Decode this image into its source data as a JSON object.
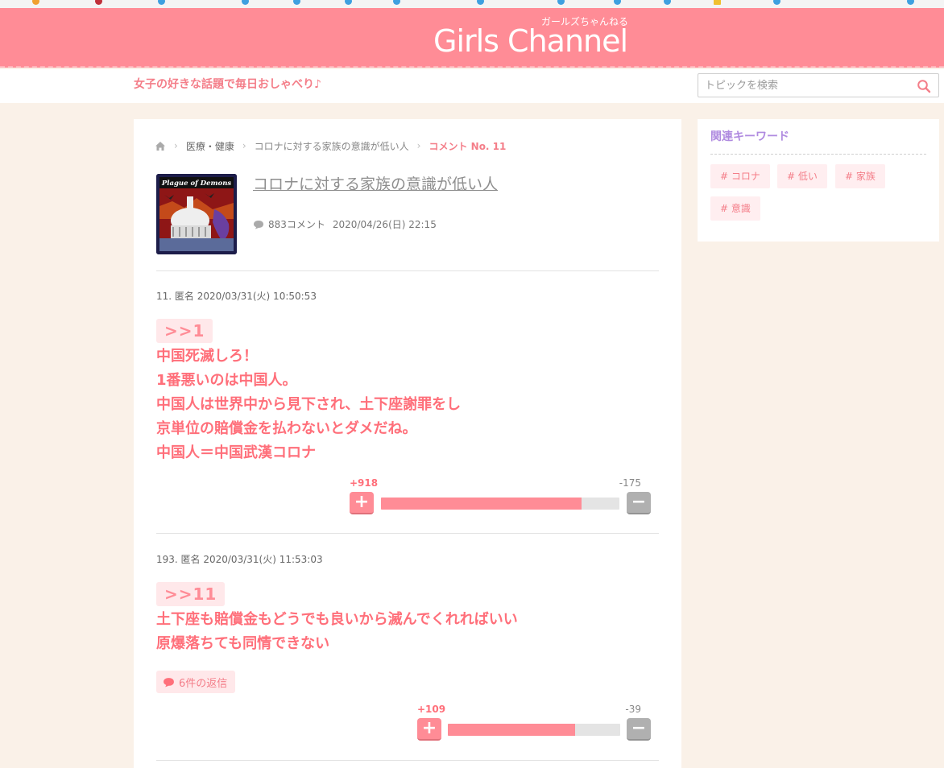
{
  "header": {
    "logo": "Girls Channel",
    "logo_sub": "ガールズちゃんねる",
    "tagline": "女子の好きな話題で毎日おしゃべり♪",
    "search_placeholder": "トピックを検索"
  },
  "breadcrumb": {
    "items": [
      "医療・健康",
      "コロナに対する家族の意識が低い人",
      "コメント No. 11"
    ]
  },
  "topic": {
    "title": "コロナに対する家族の意識が低い人",
    "comment_count": "883コメント",
    "date": "2020/04/26(日) 22:15",
    "thumbnail_caption": "Plague of Demons"
  },
  "comments": [
    {
      "header": "11. 匿名 2020/03/31(火) 10:50:53",
      "anchor": ">>1",
      "lines": [
        "中国死滅しろ！",
        "1番悪いのは中国人。",
        "中国人は世界中から見下され、土下座謝罪をし",
        "京単位の賠償金を払わないとダメだね。",
        "中国人＝中国武漢コロナ"
      ],
      "plus": "+918",
      "minus": "-175",
      "plus_ratio": 0.84
    },
    {
      "header": "193. 匿名 2020/03/31(火) 11:53:03",
      "anchor": ">>11",
      "lines": [
        "土下座も賠償金もどうでも良いから滅んでくれればいい",
        "原爆落ちても同情できない"
      ],
      "replies": "6件の返信",
      "plus": "+109",
      "minus": "-39",
      "plus_ratio": 0.74
    }
  ],
  "vote_labels": {
    "plus": "+",
    "minus": "−"
  },
  "sidebar": {
    "title": "関連キーワード",
    "keywords": [
      "# コロナ",
      "# 低い",
      "# 家族",
      "# 意識"
    ]
  },
  "colors": {
    "brand": "#ff8c96",
    "accent_text": "#ff6f7a",
    "keyword_title": "#b08be0"
  },
  "icons": [
    "home-icon",
    "chevron-right-icon",
    "search-icon",
    "comment-bubble-icon",
    "plus-icon",
    "minus-icon"
  ]
}
